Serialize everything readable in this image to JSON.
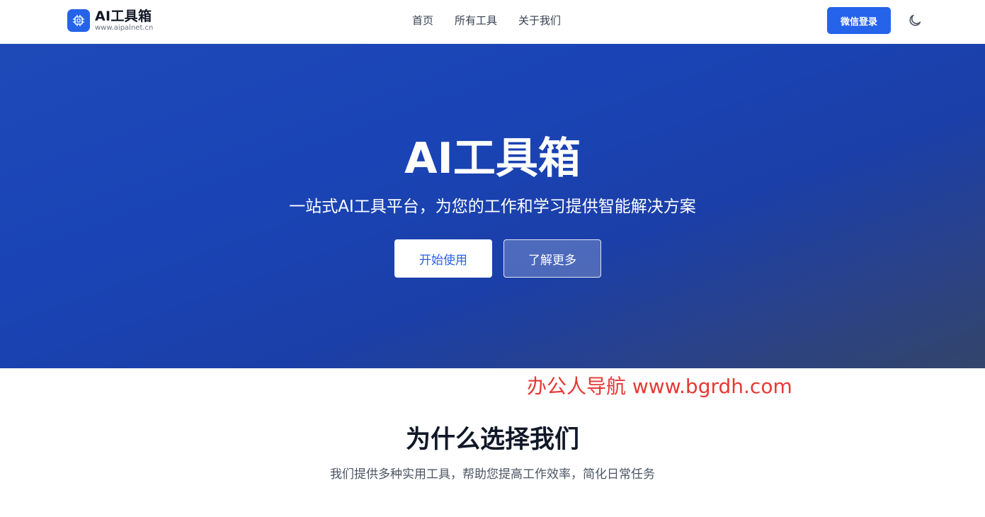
{
  "brand": {
    "name": "AI工具箱",
    "domain": "www.aipalnet.cn",
    "logo_icon": "chip-icon",
    "accent_color": "#2563eb"
  },
  "nav": {
    "links": [
      {
        "label": "首页"
      },
      {
        "label": "所有工具"
      },
      {
        "label": "关于我们"
      }
    ],
    "login_label": "微信登录",
    "theme_icon": "moon-icon"
  },
  "hero": {
    "title": "AI工具箱",
    "subtitle": "一站式AI工具平台，为您的工作和学习提供智能解决方案",
    "primary_button": "开始使用",
    "secondary_button": "了解更多"
  },
  "watermark": "办公人导航 www.bgrdh.com",
  "features": {
    "title": "为什么选择我们",
    "subtitle": "我们提供多种实用工具，帮助您提高工作效率，简化日常任务"
  }
}
